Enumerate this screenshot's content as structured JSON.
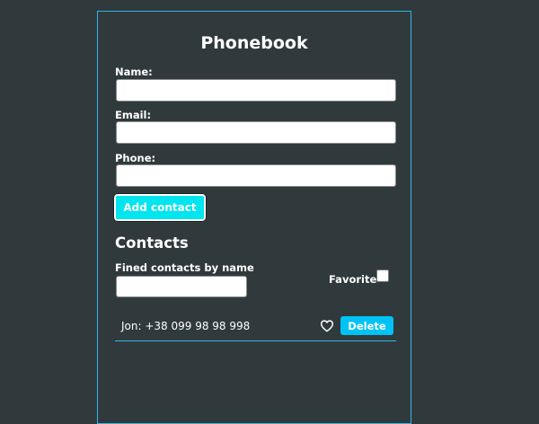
{
  "app": {
    "title": "Phonebook"
  },
  "form": {
    "name_label": "Name:",
    "name_value": "",
    "email_label": "Email:",
    "email_value": "",
    "phone_label": "Phone:",
    "phone_value": "",
    "add_button_label": "Add contact"
  },
  "contacts": {
    "heading": "Contacts",
    "filter_label": "Fined contacts by name",
    "filter_value": "",
    "favorite_label": "Favorite",
    "favorite_checked": false,
    "items": [
      {
        "text": "Jon: +38 099 98 98 998",
        "favorite_icon": "heart-outline-icon",
        "delete_label": "Delete"
      }
    ]
  },
  "colors": {
    "background": "#303a3c",
    "border_accent": "#2fb6e6",
    "add_button": "#00e5ee",
    "delete_button": "#00c2f5"
  }
}
